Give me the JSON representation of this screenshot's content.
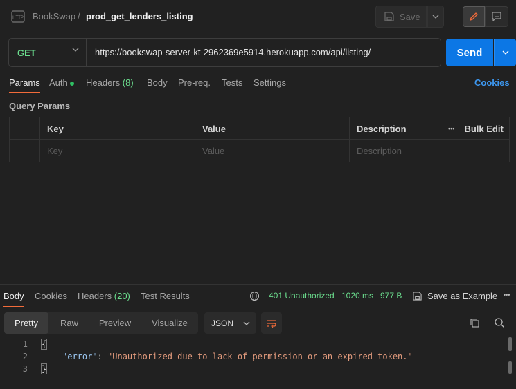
{
  "header": {
    "collection": "BookSwap",
    "separator": "/",
    "request_name": "prod_get_lenders_listing",
    "save_label": "Save",
    "icons": {
      "request_type": "http-icon",
      "save": "save-icon",
      "edit": "pencil-icon",
      "comment": "comment-icon"
    }
  },
  "request": {
    "method": "GET",
    "url": "https://bookswap-server-kt-2962369e5914.herokuapp.com/api/listing/",
    "send_label": "Send"
  },
  "request_tabs": {
    "params": "Params",
    "auth": "Auth",
    "headers": "Headers",
    "headers_count": "(8)",
    "body": "Body",
    "prereq": "Pre-req.",
    "tests": "Tests",
    "settings": "Settings",
    "cookies": "Cookies",
    "active": "Params"
  },
  "query_params": {
    "title": "Query Params",
    "columns": {
      "key": "Key",
      "value": "Value",
      "description": "Description"
    },
    "bulk_edit": "Bulk Edit",
    "more": "•••",
    "placeholder_row": {
      "key": "Key",
      "value": "Value",
      "description": "Description"
    }
  },
  "response_tabs": {
    "body": "Body",
    "cookies": "Cookies",
    "headers": "Headers",
    "headers_count": "(20)",
    "test_results": "Test Results",
    "active": "Body"
  },
  "response_meta": {
    "status": "401 Unauthorized",
    "time": "1020 ms",
    "size": "977 B",
    "save_example": "Save as Example",
    "status_color": "#6bdd8e"
  },
  "response_view": {
    "modes": [
      "Pretty",
      "Raw",
      "Preview",
      "Visualize"
    ],
    "active_mode": "Pretty",
    "format": "JSON"
  },
  "response_body": {
    "line_numbers": [
      "1",
      "2",
      "3"
    ],
    "open_brace": "{",
    "key": "\"error\"",
    "colon": ": ",
    "value": "\"Unauthorized due to lack of permission or an expired token.\"",
    "close_brace": "}"
  }
}
